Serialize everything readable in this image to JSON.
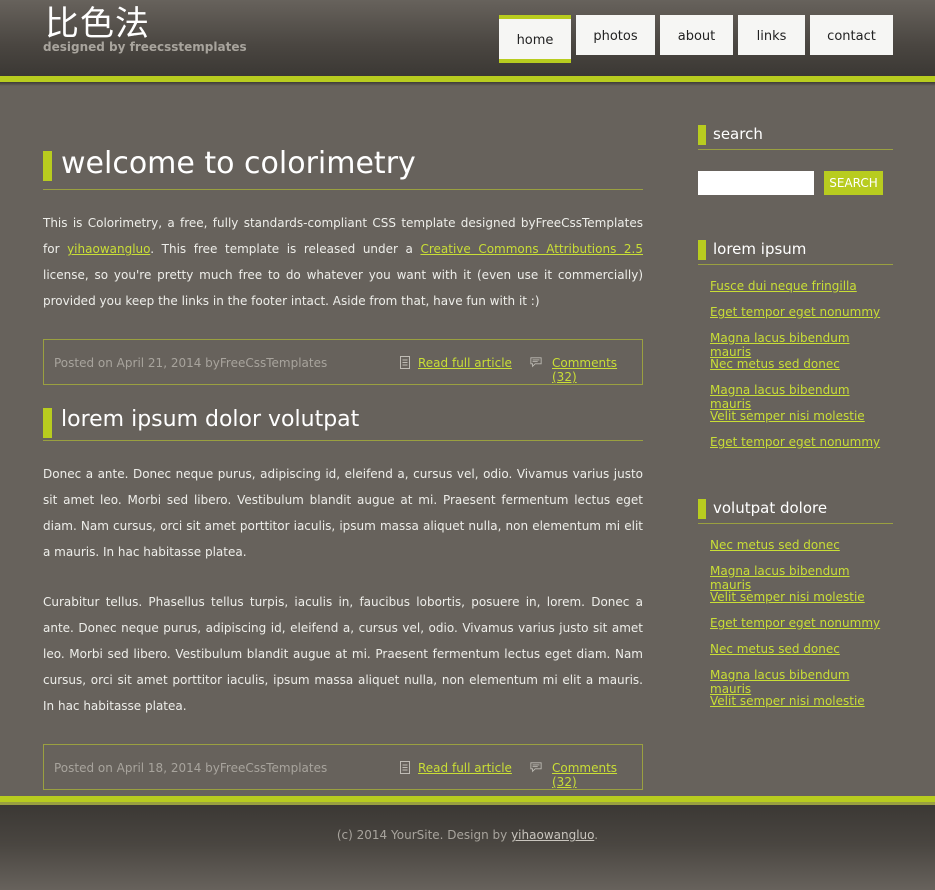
{
  "logo": {
    "title": "比色法",
    "subtitle": "designed by freecsstemplates"
  },
  "nav": {
    "items": [
      {
        "label": "home",
        "active": true
      },
      {
        "label": "photos",
        "active": false
      },
      {
        "label": "about",
        "active": false
      },
      {
        "label": "links",
        "active": false
      },
      {
        "label": "contact",
        "active": false
      }
    ]
  },
  "posts": [
    {
      "title": "welcome to colorimetry",
      "p1_before": "This is Colorimetry, a free, fully standards-compliant CSS template designed byFreeCssTemplates for ",
      "p1_link1": "yihaowangluo",
      "p1_mid": ". This free template is released under a ",
      "p1_link2": "Creative Commons Attributions 2.5",
      "p1_after": " license, so you're pretty much free to do whatever you want with it (even use it commercially) provided you keep the links in the footer intact. Aside from that, have fun with it :)",
      "posted": "Posted on April 21, 2014 byFreeCssTemplates",
      "read_more": "Read full article",
      "comments": "Comments (32)"
    },
    {
      "title": "lorem ipsum dolor volutpat",
      "p1": "Donec a ante. Donec neque purus, adipiscing id, eleifend a, cursus vel, odio. Vivamus varius justo sit amet leo. Morbi sed libero. Vestibulum blandit augue at mi. Praesent fermentum lectus eget diam. Nam cursus, orci sit amet porttitor iaculis, ipsum massa aliquet nulla, non elementum mi elit a mauris. In hac habitasse platea.",
      "p2": "Curabitur tellus. Phasellus tellus turpis, iaculis in, faucibus lobortis, posuere in, lorem. Donec a ante. Donec neque purus, adipiscing id, eleifend a, cursus vel, odio. Vivamus varius justo sit amet leo. Morbi sed libero. Vestibulum blandit augue at mi. Praesent fermentum lectus eget diam. Nam cursus, orci sit amet porttitor iaculis, ipsum massa aliquet nulla, non elementum mi elit a mauris. In hac habitasse platea.",
      "posted": "Posted on April 18, 2014 byFreeCssTemplates",
      "read_more": "Read full article",
      "comments": "Comments (32)"
    }
  ],
  "sidebar": {
    "search": {
      "title": "search",
      "placeholder": "",
      "button": "Search"
    },
    "lorem": {
      "title": "lorem ipsum",
      "links": [
        "Fusce dui neque fringilla",
        "Eget tempor eget nonummy",
        "Magna lacus bibendum mauris",
        "Nec metus sed donec",
        "Magna lacus bibendum mauris",
        "Velit semper nisi molestie",
        "Eget tempor eget nonummy"
      ]
    },
    "volutpat": {
      "title": "volutpat dolore",
      "links": [
        "Nec metus sed donec",
        "Magna lacus bibendum mauris",
        "Velit semper nisi molestie",
        "Eget tempor eget nonummy",
        "Nec metus sed donec",
        "Magna lacus bibendum mauris",
        "Velit semper nisi molestie"
      ]
    }
  },
  "footer": {
    "before": "(c) 2014 YourSite. Design by ",
    "link": "yihaowangluo",
    "after": "."
  },
  "colors": {
    "accent": "#b8cc1f",
    "background": "#67625c",
    "link": "#c9de36"
  }
}
